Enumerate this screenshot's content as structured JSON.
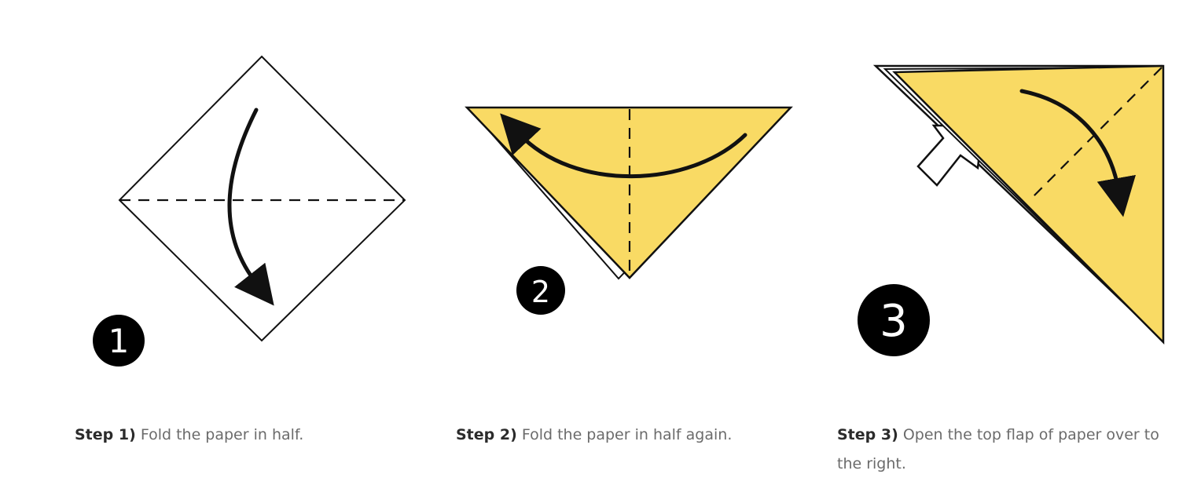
{
  "colors": {
    "paper_fill": "#f9da64",
    "outline": "#111111",
    "badge": "#000000",
    "label_text": "#2b2b2b",
    "body_text": "#6b6b6b"
  },
  "steps": [
    {
      "number": "1",
      "label": "Step 1)",
      "text": " Fold the paper in half."
    },
    {
      "number": "2",
      "label": "Step 2)",
      "text": " Fold the paper in half again."
    },
    {
      "number": "3",
      "label": "Step 3)",
      "text": " Open the top flap of paper over to the right."
    }
  ]
}
